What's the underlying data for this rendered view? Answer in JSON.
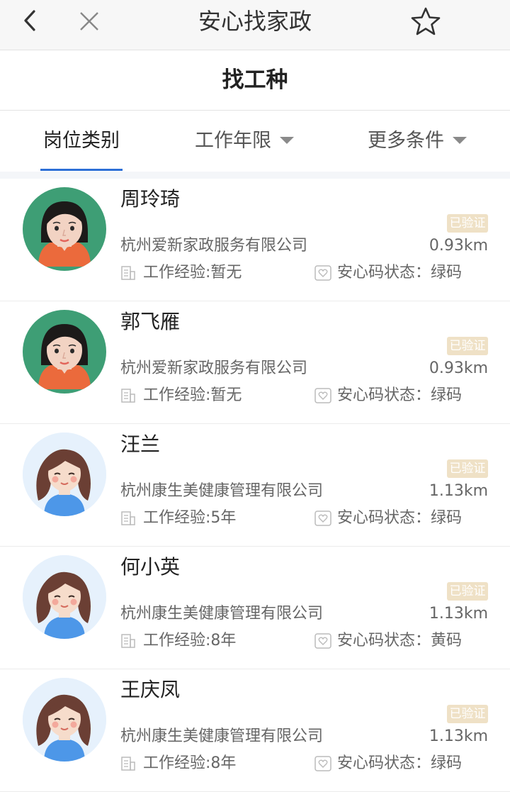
{
  "header": {
    "title": "安心找家政"
  },
  "subtitle": "找工种",
  "filters": [
    {
      "label": "岗位类别",
      "active": true
    },
    {
      "label": "工作年限",
      "active": false
    },
    {
      "label": "更多条件",
      "active": false
    }
  ],
  "colors": {
    "accent": "#2d6fd6",
    "verified_bg": "#efe1c6",
    "avatar_green": "#3e9e75",
    "avatar_lightblue": "#e6f1fc"
  },
  "list": [
    {
      "name": "周玲琦",
      "company": "杭州爱新家政服务有限公司",
      "distance": "0.93km",
      "experience": "工作经验:暂无",
      "health_status": "安心码状态：绿码",
      "verified": "已验证",
      "avatar": "woman-green-avatar-icon"
    },
    {
      "name": "郭飞雁",
      "company": "杭州爱新家政服务有限公司",
      "distance": "0.93km",
      "experience": "工作经验:暂无",
      "health_status": "安心码状态：绿码",
      "verified": "已验证",
      "avatar": "woman-green-avatar-icon"
    },
    {
      "name": "汪兰",
      "company": "杭州康生美健康管理有限公司",
      "distance": "1.13km",
      "experience": "工作经验:5年",
      "health_status": "安心码状态：绿码",
      "verified": "已验证",
      "avatar": "woman-blue-avatar-icon"
    },
    {
      "name": "何小英",
      "company": "杭州康生美健康管理有限公司",
      "distance": "1.13km",
      "experience": "工作经验:8年",
      "health_status": "安心码状态：黄码",
      "verified": "已验证",
      "avatar": "woman-blue-avatar-icon"
    },
    {
      "name": "王庆凤",
      "company": "杭州康生美健康管理有限公司",
      "distance": "1.13km",
      "experience": "工作经验:8年",
      "health_status": "安心码状态：绿码",
      "verified": "已验证",
      "avatar": "woman-blue-avatar-icon"
    }
  ]
}
